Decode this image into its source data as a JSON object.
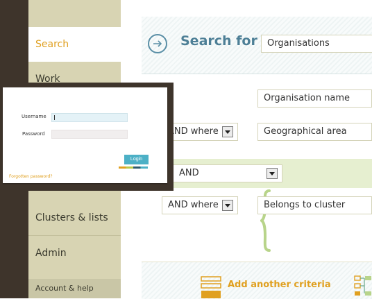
{
  "sidebar": {
    "items": [
      {
        "label": "Search"
      },
      {
        "label": "Work"
      },
      {
        "label": "Clusters & lists"
      },
      {
        "label": "Admin"
      }
    ],
    "footer": "Account & help"
  },
  "search": {
    "title": "Search for",
    "target": "Organisations",
    "criteria": {
      "field1": "Organisation name",
      "connector1": "AND where",
      "field2": "Geographical area",
      "group_connector": "AND",
      "connector2": "AND where",
      "field3": "Belongs to cluster"
    },
    "add_criteria": "Add another criteria"
  },
  "login": {
    "username_label": "Username",
    "password_label": "Password",
    "login_button": "Login",
    "forgot_link": "Forgotten password?",
    "strip_colors": [
      "#e0a020",
      "#b8c84a",
      "#2e5b6e",
      "#4cb0c6"
    ]
  },
  "colors": {
    "accent": "#e0a020",
    "title_blue": "#4d7f96",
    "sidebar_bg": "#d8d4b3",
    "dark": "#3e342b"
  }
}
